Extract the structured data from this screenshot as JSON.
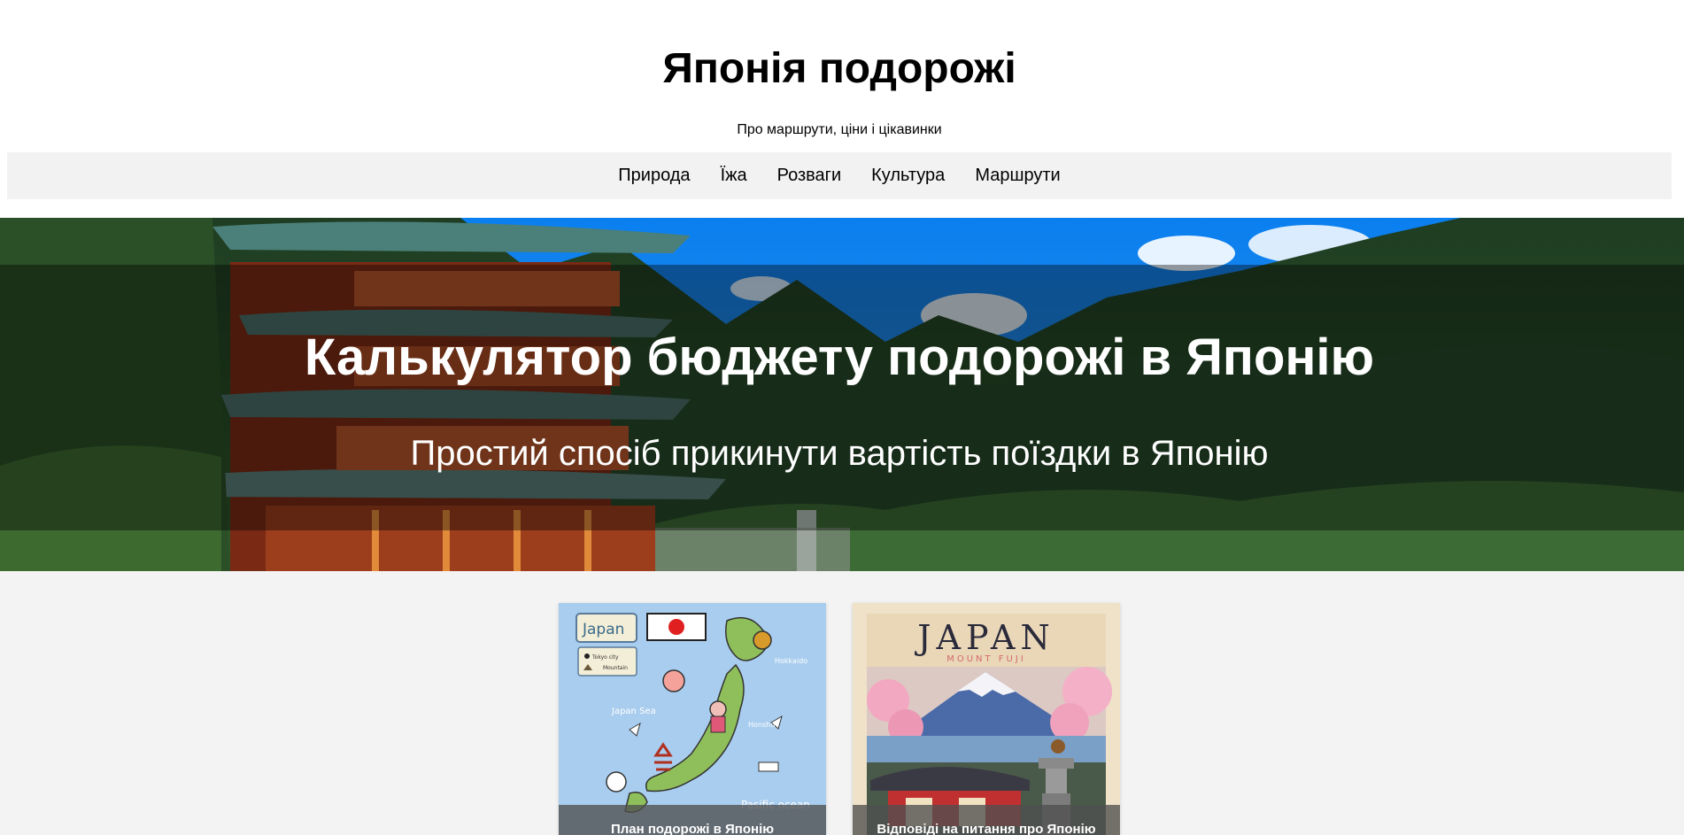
{
  "site": {
    "title": "Японія подорожі",
    "tagline": "Про маршрути, ціни і цікавинки"
  },
  "nav": {
    "items": [
      {
        "label": "Природа"
      },
      {
        "label": "Їжа"
      },
      {
        "label": "Розваги"
      },
      {
        "label": "Культура"
      },
      {
        "label": "Маршрути"
      }
    ]
  },
  "hero": {
    "title": "Калькулятор бюджету подорожі в Японію",
    "subtitle": "Простий спосіб прикинути вартість поїздки в Японію"
  },
  "cards": [
    {
      "caption": "План подорожі в Японію",
      "image": {
        "label_japan": "Japan",
        "legend_city": "Tokyo  city",
        "legend_mountain": "Mountain",
        "sea": "Japan Sea",
        "island_north": "Hokkaido",
        "island_main": "Honshu",
        "ocean": "Pasific ocean"
      }
    },
    {
      "caption": "Відповіді на питання про Японію",
      "image": {
        "poster_title": "JAPAN",
        "poster_subtitle": "MOUNT FUJI"
      }
    }
  ],
  "colors": {
    "nav_bg": "#f2f2f2",
    "cards_bg": "#f3f3f3",
    "hero_text": "#ffffff"
  }
}
